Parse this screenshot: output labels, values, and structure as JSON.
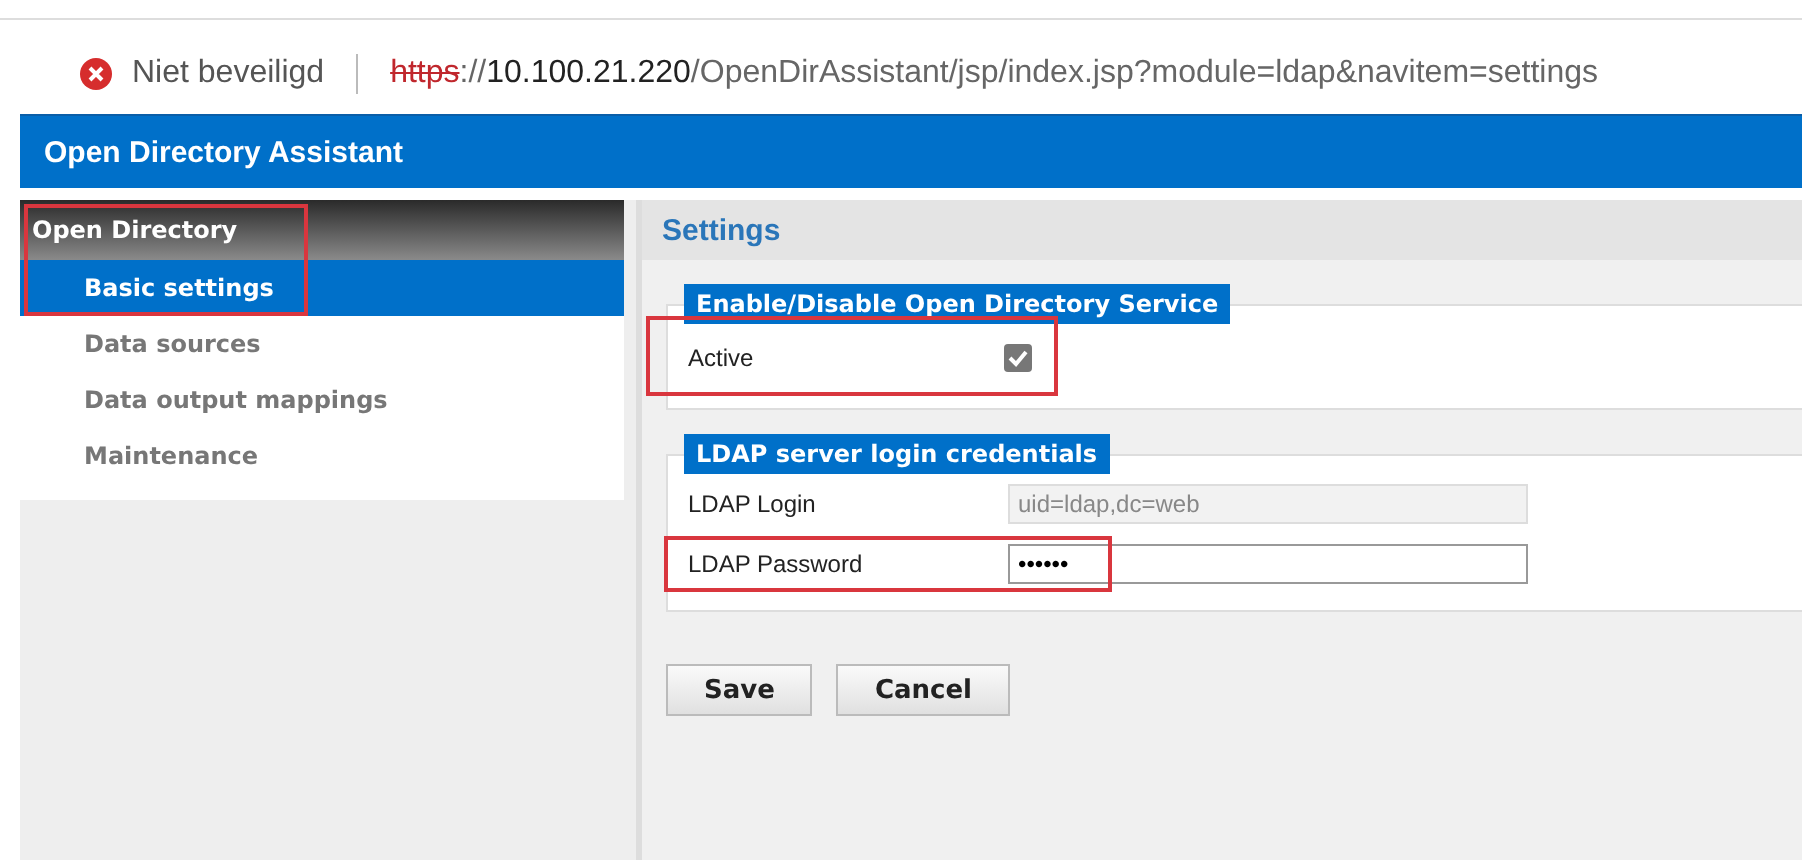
{
  "address_bar": {
    "security_label": "Niet beveiligd",
    "url": [
      {
        "kind": "scheme",
        "text": "https"
      },
      {
        "kind": "plain",
        "text": "://"
      },
      {
        "kind": "host",
        "text": "10.100.21.220"
      },
      {
        "kind": "path",
        "text": "/OpenDirAssistant/jsp/index.jsp?module=ldap&navitem=settings"
      }
    ]
  },
  "app_title": "Open Directory Assistant",
  "sidebar": {
    "header": "Open Directory",
    "highlighted": true,
    "items": [
      {
        "label": "Basic settings",
        "selected": true
      },
      {
        "label": "Data sources",
        "selected": false
      },
      {
        "label": "Data output mappings",
        "selected": false
      },
      {
        "label": "Maintenance",
        "selected": false
      }
    ]
  },
  "page_title": "Settings",
  "sections": [
    {
      "legend": "Enable/Disable Open Directory Service",
      "rows": [
        {
          "kind": "checkbox",
          "label": "Active",
          "checked": true,
          "disabled": true,
          "highlighted": true
        }
      ]
    },
    {
      "legend": "LDAP server login credentials",
      "rows": [
        {
          "kind": "text",
          "label": "LDAP Login",
          "value": "uid=ldap,dc=web",
          "disabled": true,
          "highlighted": false
        },
        {
          "kind": "password",
          "label": "LDAP Password",
          "value": "••••••",
          "disabled": false,
          "highlighted": true
        }
      ]
    }
  ],
  "buttons": [
    "Save",
    "Cancel"
  ]
}
